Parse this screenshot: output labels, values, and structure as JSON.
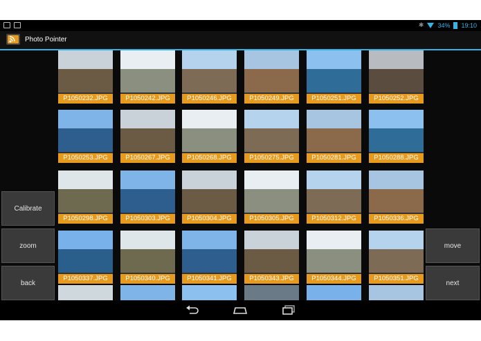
{
  "app": {
    "title": "Photo Pointer"
  },
  "status": {
    "battery": "34%",
    "time": "19:10"
  },
  "icons": {
    "notif1": "camera-icon",
    "notif2": "checkbox-icon",
    "bt": "bluetooth-icon",
    "wifi": "wifi-icon",
    "battery": "battery-icon",
    "app": "rss-icon",
    "back": "back-arrow-icon",
    "home": "home-icon",
    "recents": "recents-icon"
  },
  "left_buttons": [
    "Calibrate",
    "zoom",
    "back"
  ],
  "right_buttons": [
    "move",
    "next"
  ],
  "photos": [
    "P1050232.JPG",
    "P1050242.JPG",
    "P1050246.JPG",
    "P1050249.JPG",
    "P1050251.JPG",
    "P1050252.JPG",
    "P1050253.JPG",
    "P1050267.JPG",
    "P1050268.JPG",
    "P1050275.JPG",
    "P1050281.JPG",
    "P1050288.JPG",
    "P1050298.JPG",
    "P1050303.JPG",
    "P1050304.JPG",
    "P1050305.JPG",
    "P1050312.JPG",
    "P1050336.JPG",
    "P1050337.JPG",
    "P1050340.JPG",
    "P1050341.JPG",
    "P1050343.JPG",
    "P1050344.JPG",
    "P1050351.JPG"
  ],
  "colors": {
    "accent": "#33b5e5",
    "caption": "#e69a1e"
  }
}
